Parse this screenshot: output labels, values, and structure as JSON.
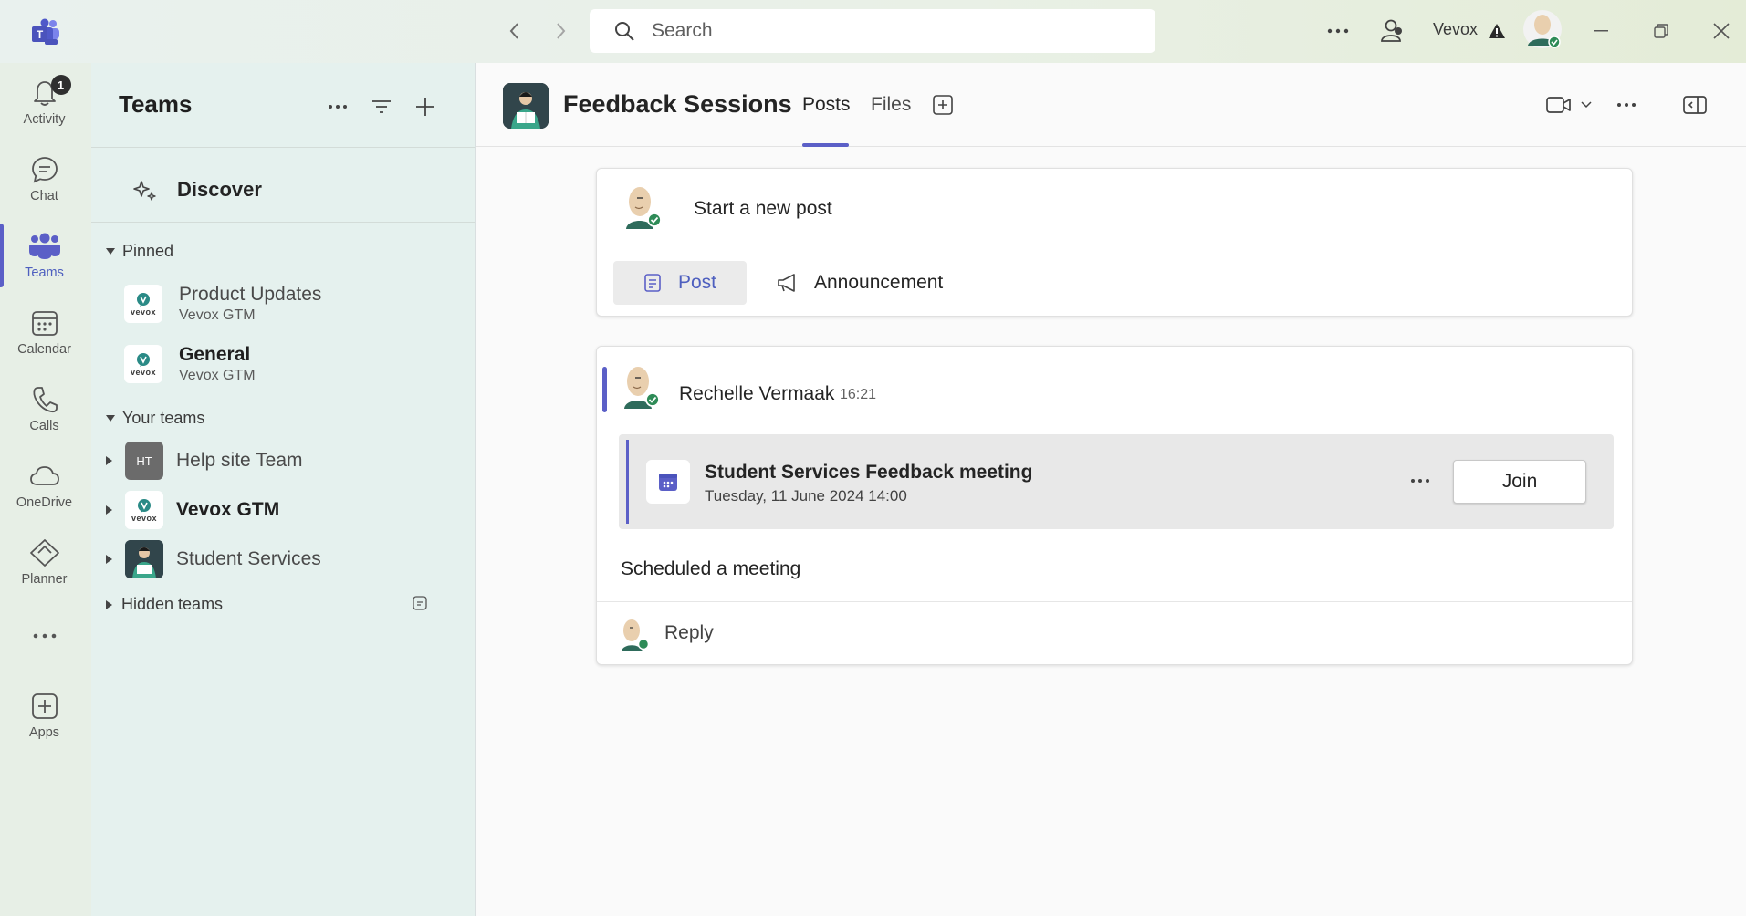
{
  "app": {
    "icon": "teams-logo"
  },
  "titlebar": {
    "back_icon": "chevron-left-icon",
    "forward_icon": "chevron-right-icon",
    "search_placeholder": "Search",
    "more_icon": "ellipsis-icon",
    "org_name": "Vevox",
    "warning_icon": "warning-icon"
  },
  "rail": {
    "items": [
      {
        "label": "Activity",
        "icon": "bell-icon",
        "badge": "1"
      },
      {
        "label": "Chat",
        "icon": "chat-icon"
      },
      {
        "label": "Teams",
        "icon": "teams-icon",
        "active": true
      },
      {
        "label": "Calendar",
        "icon": "calendar-icon"
      },
      {
        "label": "Calls",
        "icon": "phone-icon"
      },
      {
        "label": "OneDrive",
        "icon": "cloud-icon"
      },
      {
        "label": "Planner",
        "icon": "planner-icon"
      },
      {
        "label": "",
        "icon": "more-icon"
      },
      {
        "label": "Apps",
        "icon": "add-app-icon"
      }
    ]
  },
  "teams_pane": {
    "title": "Teams",
    "discover": "Discover",
    "pinned_label": "Pinned",
    "pinned": [
      {
        "name": "Product Updates",
        "team": "Vevox GTM",
        "bold": false
      },
      {
        "name": "General",
        "team": "Vevox GTM",
        "bold": true
      }
    ],
    "your_teams_label": "Your teams",
    "teams": [
      {
        "name": "Help site Team",
        "initials": "HT",
        "bold": false
      },
      {
        "name": "Vevox GTM",
        "bold": true
      },
      {
        "name": "Student Services",
        "bold": false
      }
    ],
    "hidden_label": "Hidden teams",
    "logo_text": "vevox"
  },
  "channel": {
    "title": "Feedback Sessions",
    "tabs": [
      "Posts",
      "Files"
    ],
    "active_tab": "Posts"
  },
  "compose": {
    "prompt": "Start a new post",
    "post_label": "Post",
    "announcement_label": "Announcement"
  },
  "thread": {
    "author": "Rechelle Vermaak",
    "time": "16:21",
    "meeting_title": "Student Services Feedback meeting",
    "meeting_date": "Tuesday, 11 June 2024 14:00",
    "join_label": "Join",
    "message": "Scheduled a meeting",
    "reply_label": "Reply"
  },
  "colors": {
    "accent": "#5b5fc7",
    "online": "#2e8b57"
  }
}
